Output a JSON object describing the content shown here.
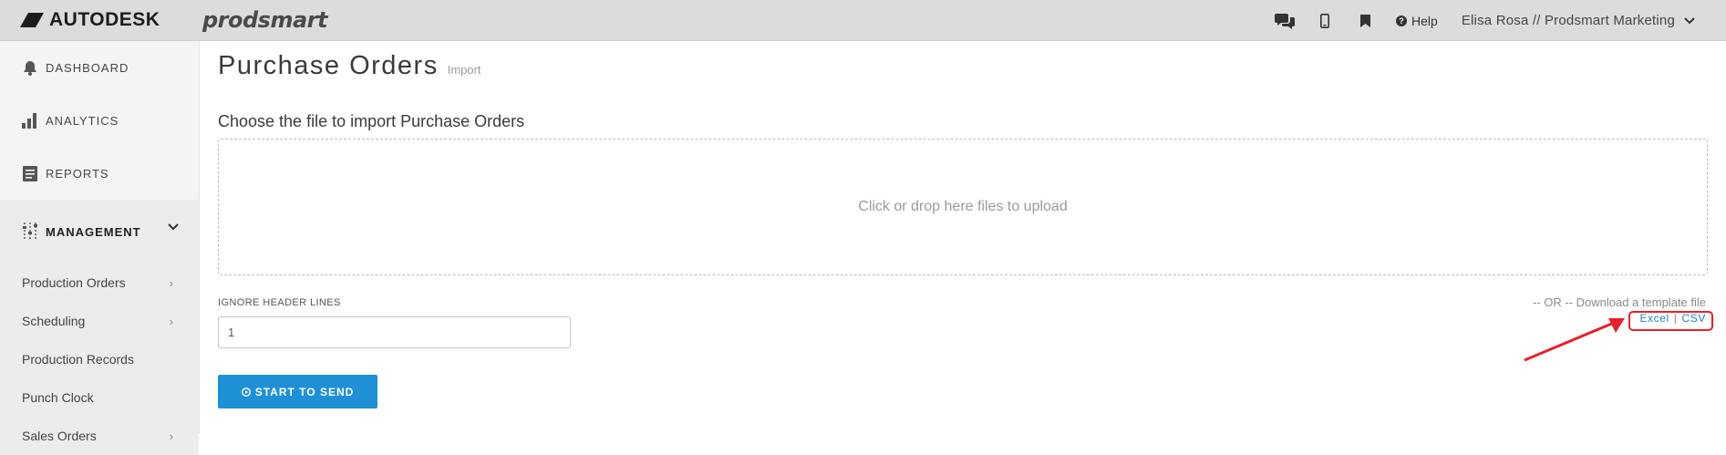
{
  "header": {
    "brand": "AUTODESK",
    "product": "prodsmart",
    "help": "Help",
    "user": "Elisa Rosa // Prodsmart Marketing",
    "icons": [
      "chat-icon",
      "mobile-icon",
      "bookmark-icon",
      "help-icon",
      "chevron-down-icon"
    ]
  },
  "sidebar": {
    "main_items": [
      {
        "label": "DASHBOARD",
        "icon": "bell-icon"
      },
      {
        "label": "ANALYTICS",
        "icon": "bar-chart-icon"
      },
      {
        "label": "REPORTS",
        "icon": "reports-icon"
      }
    ],
    "management": {
      "label": "MANAGEMENT",
      "icon": "sliders-icon"
    },
    "sub_items": [
      {
        "label": "Production Orders",
        "has_arrow": true
      },
      {
        "label": "Scheduling",
        "has_arrow": true
      },
      {
        "label": "Production Records",
        "has_arrow": false
      },
      {
        "label": "Punch Clock",
        "has_arrow": false
      },
      {
        "label": "Sales Orders",
        "has_arrow": true
      }
    ]
  },
  "main": {
    "title": "Purchase Orders",
    "subtitle": "Import",
    "choose_label": "Choose the file to import Purchase Orders",
    "dropzone_text": "Click or drop here files to upload",
    "ignore_header_label": "IGNORE HEADER LINES",
    "ignore_header_value": "1",
    "start_button": "START TO SEND",
    "or_text": "-- OR -- Download a template file",
    "template_excel": "Excel",
    "template_sep": "|",
    "template_csv": "CSV"
  },
  "colors": {
    "accent": "#1e90d6",
    "link": "#1e84cc",
    "annotation": "#e8202a"
  }
}
